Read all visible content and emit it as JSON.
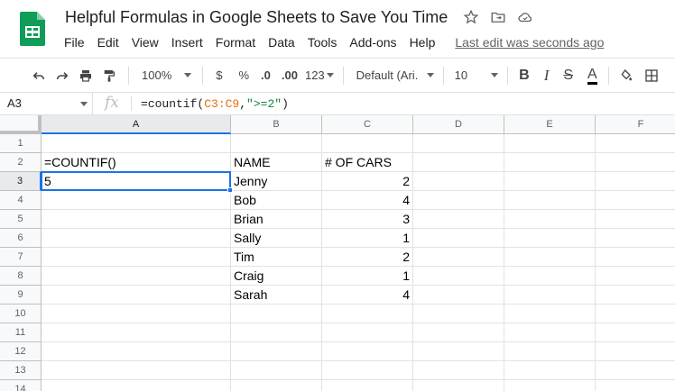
{
  "document": {
    "title": "Helpful Formulas in Google Sheets to Save You Time",
    "last_edit": "Last edit was seconds ago"
  },
  "menu": [
    "File",
    "Edit",
    "View",
    "Insert",
    "Format",
    "Data",
    "Tools",
    "Add-ons",
    "Help"
  ],
  "toolbar": {
    "zoom": "100%",
    "currency": "$",
    "percent": "%",
    "decrease_decimal": ".0",
    "increase_decimal": ".00",
    "more_formats": "123",
    "font": "Default (Ari...",
    "font_size": "10",
    "bold": "B",
    "italic": "I",
    "strike": "S",
    "text_color": "A"
  },
  "formula_bar": {
    "cell_ref": "A3",
    "fx_label": "fx",
    "formula_prefix": "=countif(",
    "formula_range": "C3:C9",
    "formula_sep": ",",
    "formula_criteria": "\">=2\"",
    "formula_suffix": ")"
  },
  "grid": {
    "columns": [
      "A",
      "B",
      "C",
      "D",
      "E",
      "F"
    ],
    "selected_column": "A",
    "rows": [
      "1",
      "2",
      "3",
      "4",
      "5",
      "6",
      "7",
      "8",
      "9",
      "10",
      "11",
      "12",
      "13",
      "14"
    ],
    "selected_row": "3",
    "active_cell": "A3",
    "cells": {
      "A2": "=COUNTIF()",
      "A3": "5",
      "B2": "NAME",
      "C2": "# OF CARS",
      "B3": "Jenny",
      "C3": "2",
      "B4": "Bob",
      "C4": "4",
      "B5": "Brian",
      "C5": "3",
      "B6": "Sally",
      "C6": "1",
      "B7": "Tim",
      "C7": "2",
      "B8": "Craig",
      "C8": "1",
      "B9": "Sarah",
      "C9": "4"
    }
  },
  "colors": {
    "accent": "#1a73e8",
    "sheets_green": "#0f9d58",
    "range_orange": "#e8710a",
    "string_green": "#188038"
  }
}
